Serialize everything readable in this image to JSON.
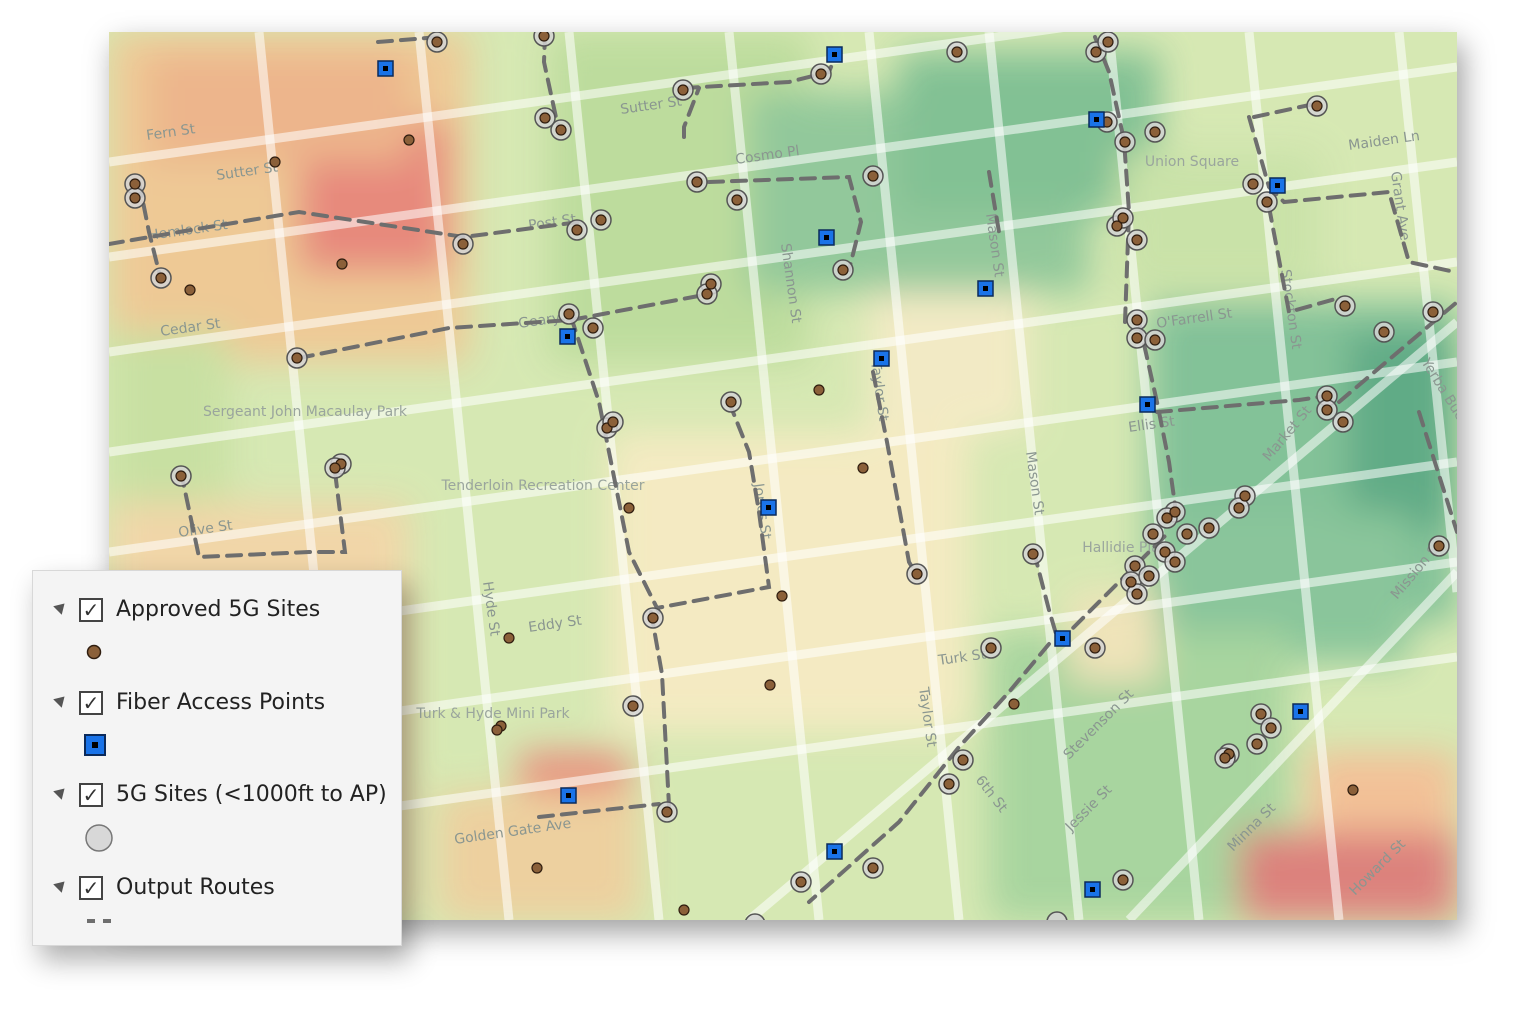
{
  "legend": {
    "layers": [
      {
        "label": "Approved 5G Sites",
        "checked": true,
        "symbol": "brown-dot-icon",
        "color": "#8b6039"
      },
      {
        "label": "Fiber Access Points",
        "checked": true,
        "symbol": "blue-square-icon",
        "color": "#1a73e8"
      },
      {
        "label": "5G Sites (<1000ft to AP)",
        "checked": true,
        "symbol": "gray-circle-icon",
        "color": "#d4d4d4"
      },
      {
        "label": "Output Routes",
        "checked": true,
        "symbol": "dashed-line-icon",
        "color": "#6e6e6e"
      }
    ]
  },
  "map": {
    "streets": [
      "Fern St",
      "Sutter St",
      "Hemlock St",
      "Cedar St",
      "Olive St",
      "Post St",
      "Geary St",
      "Cosmo Pl",
      "Shannon St",
      "Mason St",
      "Taylor St",
      "Jones St",
      "Hyde St",
      "Eddy St",
      "Turk St",
      "Golden Gate Ave",
      "O'Farrell St",
      "Ellis St",
      "Maiden Ln",
      "Grant Ave",
      "Stockton St",
      "Market St",
      "Yerba Buena Ln",
      "Mission St",
      "6th St",
      "Stevenson St",
      "Jessie St",
      "Minna St",
      "Howard St",
      "Natoma St"
    ],
    "places": [
      "Sergeant John Macaulay Park",
      "Tenderloin Recreation Center",
      "Union Square",
      "Turk & Hyde Mini Park",
      "Hallidie Plaza"
    ],
    "colors": {
      "heat_high": "#e8837a",
      "heat_mid_high": "#f2b98c",
      "heat_mid": "#f6e8bd",
      "heat_mid_low": "#c5e0a5",
      "heat_low": "#8ec99a",
      "heat_lowest": "#5cab85"
    }
  }
}
